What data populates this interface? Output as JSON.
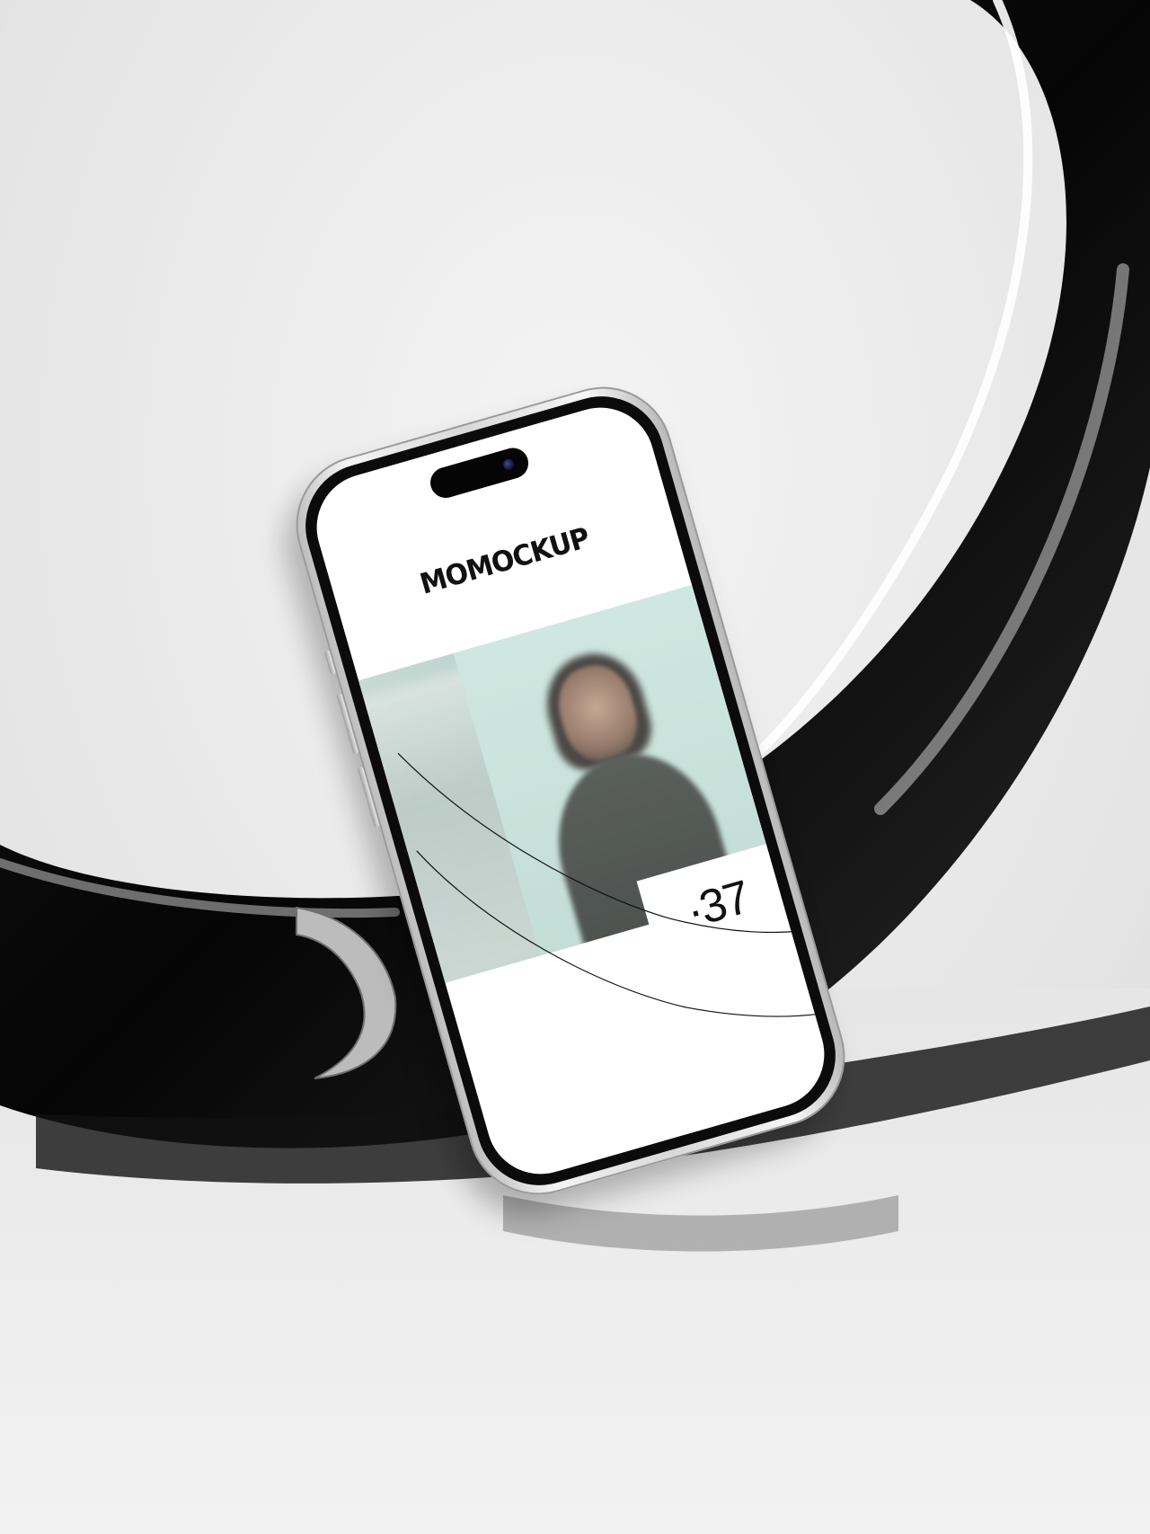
{
  "scene": {
    "description_colors": {
      "background": "#e9e9e9",
      "ring": "#0b0b0b",
      "phone_frame": "#d8d8d8",
      "photo_tint": "#c0ddd5"
    }
  },
  "phone": {
    "screen": {
      "brand_text": "MOMOCKUP",
      "counter_text": "·37"
    }
  }
}
